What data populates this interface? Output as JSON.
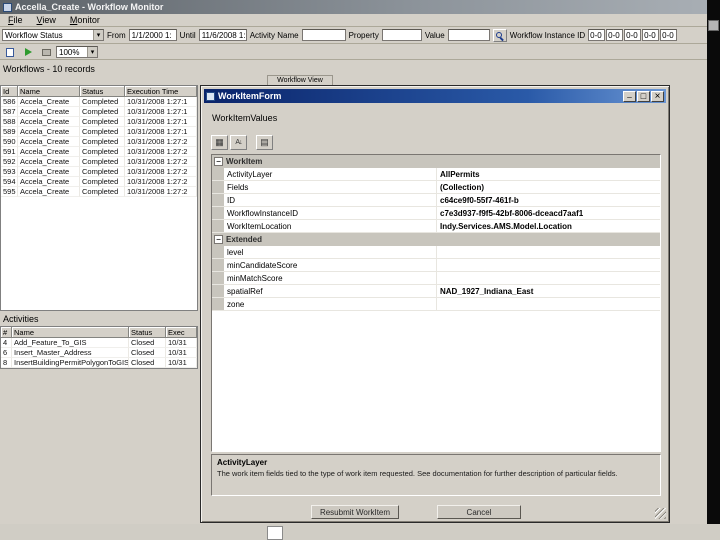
{
  "window": {
    "title": "Accella_Create - Workflow Monitor",
    "menu": [
      "File",
      "View",
      "Monitor"
    ]
  },
  "filters": {
    "status_value": "Workflow Status",
    "from_label": "From",
    "from_value": "1/1/2000 1:",
    "until_label": "Until",
    "until_value": "11/6/2008 1:",
    "activity_label": "Activity Name",
    "activity_value": "",
    "property_label": "Property",
    "property_value": "",
    "value_label": "Value",
    "value_value": "",
    "instance_label": "Workflow Instance ID",
    "instance_segments": [
      "0-0",
      "0-0",
      "0-0",
      "0-0",
      "0-0"
    ]
  },
  "toolbar": {
    "zoom": "100%"
  },
  "workflows": {
    "header": "Workflows - 10 records",
    "columns": [
      "Id",
      "Name",
      "Status",
      "Execution Time"
    ],
    "rows": [
      [
        "586",
        "Accela_Create",
        "Completed",
        "10/31/2008 1:27:1"
      ],
      [
        "587",
        "Accela_Create",
        "Completed",
        "10/31/2008 1:27:1"
      ],
      [
        "588",
        "Accela_Create",
        "Completed",
        "10/31/2008 1:27:1"
      ],
      [
        "589",
        "Accela_Create",
        "Completed",
        "10/31/2008 1:27:1"
      ],
      [
        "590",
        "Accela_Create",
        "Completed",
        "10/31/2008 1:27:2"
      ],
      [
        "591",
        "Accela_Create",
        "Completed",
        "10/31/2008 1:27:2"
      ],
      [
        "592",
        "Accela_Create",
        "Completed",
        "10/31/2008 1:27:2"
      ],
      [
        "593",
        "Accela_Create",
        "Completed",
        "10/31/2008 1:27:2"
      ],
      [
        "594",
        "Accela_Create",
        "Completed",
        "10/31/2008 1:27:2"
      ],
      [
        "595",
        "Accela_Create",
        "Completed",
        "10/31/2008 1:27:2"
      ]
    ]
  },
  "view_tab": "Workflow View",
  "activities": {
    "header": "Activities",
    "columns": [
      "#",
      "Name",
      "Status",
      "Exec"
    ],
    "rows": [
      [
        "4",
        "Add_Feature_To_GIS",
        "Closed",
        "10/31"
      ],
      [
        "6",
        "Insert_Master_Address",
        "Closed",
        "10/31"
      ],
      [
        "8",
        "InsertBuildingPermitPolygonToGIS",
        "Closed",
        "10/31"
      ]
    ]
  },
  "dialog": {
    "title": "WorkItemForm",
    "subtitle": "WorkItemValues",
    "grid": [
      {
        "type": "category",
        "label": "WorkItem"
      },
      {
        "type": "row",
        "key": "ActivityLayer",
        "value": "AllPermits"
      },
      {
        "type": "row",
        "key": "Fields",
        "value": "(Collection)"
      },
      {
        "type": "row",
        "key": "ID",
        "value": "c64ce9f0-55f7-461f-b"
      },
      {
        "type": "row",
        "key": "WorkflowInstanceID",
        "value": "c7e3d937-f9f5-42bf-8006-dceacd7aaf1"
      },
      {
        "type": "row",
        "key": "WorkItemLocation",
        "value": "Indy.Services.AMS.Model.Location"
      },
      {
        "type": "category",
        "label": "Extended"
      },
      {
        "type": "row",
        "key": "level",
        "value": ""
      },
      {
        "type": "row",
        "key": "minCandidateScore",
        "value": ""
      },
      {
        "type": "row",
        "key": "minMatchScore",
        "value": ""
      },
      {
        "type": "row",
        "key": "spatialRef",
        "value": "NAD_1927_Indiana_East"
      },
      {
        "type": "row",
        "key": "zone",
        "value": ""
      }
    ],
    "help": {
      "title": "ActivityLayer",
      "text": "The work item fields tied to the type of work item requested.  See documentation for further description of particular fields."
    },
    "buttons": {
      "resubmit": "Resubmit WorkItem",
      "cancel": "Cancel"
    }
  }
}
